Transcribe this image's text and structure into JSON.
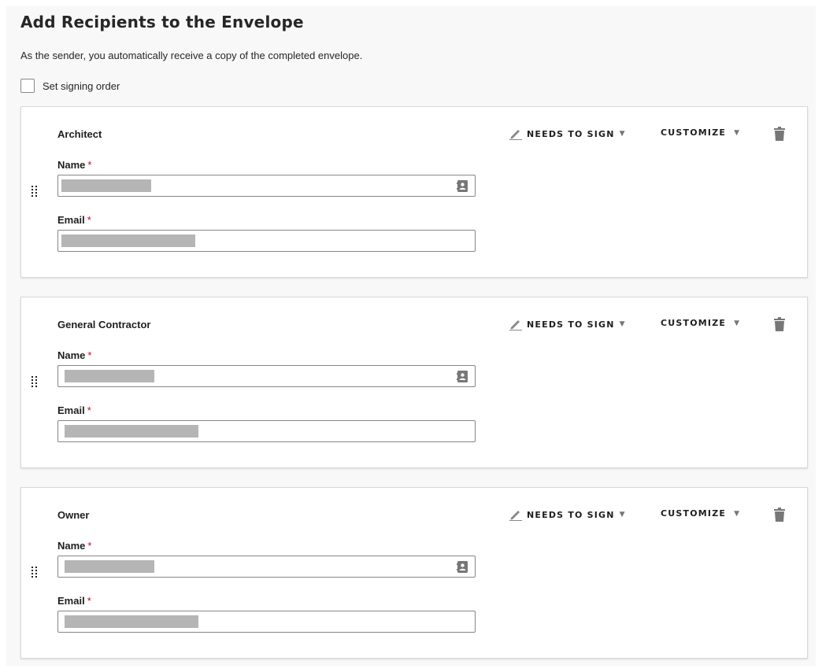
{
  "header": {
    "title": "Add Recipients to the Envelope",
    "subtitle": "As the sender, you automatically receive a copy of the completed envelope."
  },
  "signing_order": {
    "label": "Set signing order",
    "checked": false
  },
  "recipients": [
    {
      "role": "Architect",
      "action_label": "NEEDS TO SIGN",
      "customize_label": "CUSTOMIZE",
      "name_label": "Name",
      "email_label": "Email",
      "required_mark": "*",
      "name_value": "[redacted]",
      "email_value": "[redacted]"
    },
    {
      "role": "General Contractor",
      "action_label": "NEEDS TO SIGN",
      "customize_label": "CUSTOMIZE",
      "name_label": "Name",
      "email_label": "Email",
      "required_mark": "*",
      "name_value": "[redacted]",
      "email_value": "[redacted]"
    },
    {
      "role": "Owner",
      "action_label": "NEEDS TO SIGN",
      "customize_label": "CUSTOMIZE",
      "name_label": "Name",
      "email_label": "Email",
      "required_mark": "*",
      "name_value": "[redacted]",
      "email_value": "[redacted]"
    }
  ],
  "icons": {
    "caret": "▼",
    "pen": "pen-icon",
    "trash": "trash-icon",
    "contact": "contact-card-icon",
    "drag": "drag-handle-icon"
  },
  "colors": {
    "panel_bg": "#f8f8f8",
    "required": "#d0021b",
    "icon_gray": "#777777",
    "redaction": "#b5b5b5"
  }
}
